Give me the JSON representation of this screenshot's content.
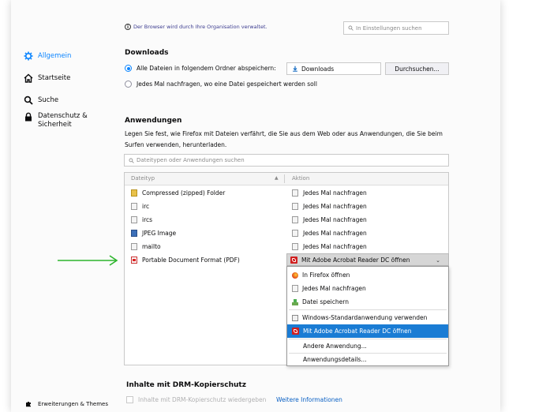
{
  "sidebar": {
    "items": [
      {
        "label": "Allgemein",
        "icon": "gear-icon",
        "selected": true
      },
      {
        "label": "Startseite",
        "icon": "home-icon"
      },
      {
        "label": "Suche",
        "icon": "search-icon"
      },
      {
        "label_line1": "Datenschutz &",
        "label_line2": "Sicherheit",
        "icon": "lock-icon"
      }
    ],
    "footer_label": "Erweiterungen & Themes",
    "footer_icon": "puzzle-icon"
  },
  "header": {
    "notice": "Der Browser wird durch Ihre Organisation verwaltet.",
    "search_placeholder": "In Einstellungen suchen"
  },
  "downloads": {
    "title": "Downloads",
    "option_save_label": "Alle Dateien in folgendem Ordner abspeichern:",
    "folder_value": "Downloads",
    "browse_button": "Durchsuchen...",
    "option_ask_label": "Jedes Mal nachfragen, wo eine Datei gespeichert werden soll"
  },
  "applications": {
    "title": "Anwendungen",
    "description_line1": "Legen Sie fest, wie Firefox mit Dateien verfährt, die Sie aus dem Web oder aus Anwendungen, die Sie beim",
    "description_line2": "Surfen verwenden, herunterladen.",
    "filter_placeholder": "Dateitypen oder Anwendungen suchen",
    "columns": [
      "Dateityp",
      "Aktion"
    ],
    "rows": [
      {
        "type": "Compressed (zipped) Folder",
        "action": "Jedes Mal nachfragen"
      },
      {
        "type": "irc",
        "action": "Jedes Mal nachfragen"
      },
      {
        "type": "ircs",
        "action": "Jedes Mal nachfragen"
      },
      {
        "type": "JPEG Image",
        "action": "Jedes Mal nachfragen"
      },
      {
        "type": "mailto",
        "action": "Jedes Mal nachfragen"
      },
      {
        "type": "Portable Document Format (PDF)",
        "action": "Mit Adobe Acrobat Reader DC öffnen"
      }
    ],
    "dropdown_options": [
      "In Firefox öffnen",
      "Jedes Mal nachfragen",
      "Datei speichern",
      "Windows-Standardanwendung verwenden",
      "Mit Adobe Acrobat Reader DC öffnen",
      "Andere Anwendung...",
      "Anwendungsdetails..."
    ]
  },
  "drm": {
    "title": "Inhalte mit DRM-Kopierschutz",
    "checkbox_label": "Inhalte mit DRM-Kopierschutz wiedergeben",
    "link": "Weitere Informationen"
  },
  "colors": {
    "accent": "#0a84ff",
    "selected_option": "#1a7cd4",
    "annotation_arrow": "#2db52d"
  }
}
